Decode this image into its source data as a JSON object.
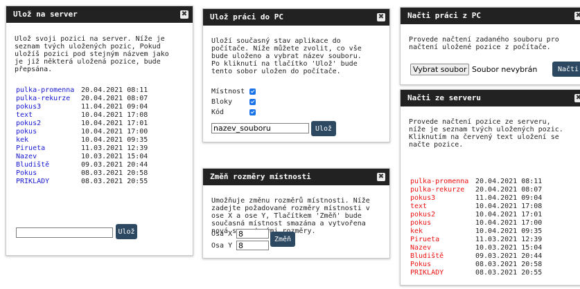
{
  "save_server": {
    "title": "Ulož na server",
    "description": "Ulož svoji pozici na server. Níže je\nseznam tvých uložených pozic, Pokud\nuložíš pozici pod stejným názvem jako\nje již některá uložená pozice, bude\npřepsána.",
    "positions": [
      {
        "name": "pulka-promenna",
        "date": "20.04.2021 08:11"
      },
      {
        "name": "pulka-rekurze",
        "date": "20.04.2021 08:07"
      },
      {
        "name": "pokus3",
        "date": "11.04.2021 09:04"
      },
      {
        "name": "text",
        "date": "10.04.2021 17:08"
      },
      {
        "name": "pokus2",
        "date": "10.04.2021 17:01"
      },
      {
        "name": "pokus",
        "date": "10.04.2021 17:00"
      },
      {
        "name": "kek",
        "date": "10.04.2021 09:35"
      },
      {
        "name": "Pirueta",
        "date": "11.03.2021 12:39"
      },
      {
        "name": "Nazev",
        "date": "10.03.2021 15:04"
      },
      {
        "name": "Bludiště",
        "date": "09.03.2021 20:44"
      },
      {
        "name": "Pokus",
        "date": "08.03.2021 20:58"
      },
      {
        "name": "PRIKLADY",
        "date": "08.03.2021 20:55"
      }
    ],
    "name_value": "",
    "button_label": "Ulož"
  },
  "save_pc": {
    "title": "Ulož práci do PC",
    "description": "Uloží současný stav aplikace do\npočítače. Níže můžete zvolit, co vše\nbude uloženo a vybrat název souboru.\nPo kliknutí na tlačítko 'Ulož' bude\ntento sobor uložen do počítače.",
    "options": [
      {
        "label": "Místnost",
        "checked": true
      },
      {
        "label": "Bloky",
        "checked": true
      },
      {
        "label": "Kód",
        "checked": true
      }
    ],
    "filename_value": "nazev_souboru",
    "button_label": "Ulož"
  },
  "resize": {
    "title": "Změň rozměry místnosti",
    "description": "Umožňuje změnu rozměrů místnosti. Níže\nzadejte požadované rozměry místnosti v\nose X a ose Y, Tlačítkem 'Změň' bude\nsoučasná místnost smazána a vytvořena\nnová se zadanými rozměry.",
    "x_label": "Osa X",
    "x_value": "8",
    "y_label": "Osa Y",
    "y_value": "8",
    "button_label": "Změň"
  },
  "load_pc": {
    "title": "Načti práci z PC",
    "description": "Provede načtení zadaného souboru pro\nnačtení uložené pozice z počítače.",
    "file_button": "Vybrat soubor",
    "file_status": "Soubor nevybrán",
    "button_label": "Načti"
  },
  "load_server": {
    "title": "Načti ze serveru",
    "description": "Provede načtení pozice ze serveru,\nníže je seznam tvých uložených pozic.\nKliknutím na červený text uložení se\nnačte pozice.",
    "positions": [
      {
        "name": "pulka-promenna",
        "date": "20.04.2021 08:11"
      },
      {
        "name": "pulka-rekurze",
        "date": "20.04.2021 08:07"
      },
      {
        "name": "pokus3",
        "date": "11.04.2021 09:04"
      },
      {
        "name": "text",
        "date": "10.04.2021 17:08"
      },
      {
        "name": "pokus2",
        "date": "10.04.2021 17:01"
      },
      {
        "name": "pokus",
        "date": "10.04.2021 17:00"
      },
      {
        "name": "kek",
        "date": "10.04.2021 09:35"
      },
      {
        "name": "Pirueta",
        "date": "11.03.2021 12:39"
      },
      {
        "name": "Nazev",
        "date": "10.03.2021 15:04"
      },
      {
        "name": "Bludiště",
        "date": "09.03.2021 20:44"
      },
      {
        "name": "Pokus",
        "date": "08.03.2021 20:58"
      },
      {
        "name": "PRIKLADY",
        "date": "08.03.2021 20:55"
      }
    ]
  },
  "icons": {
    "close": "close-icon"
  },
  "colors": {
    "header_bg": "#222222",
    "button_bg": "#2d4962",
    "link_blue": "#1515d0",
    "link_red": "#ee0f0f",
    "checkbox": "#1a73e8"
  }
}
